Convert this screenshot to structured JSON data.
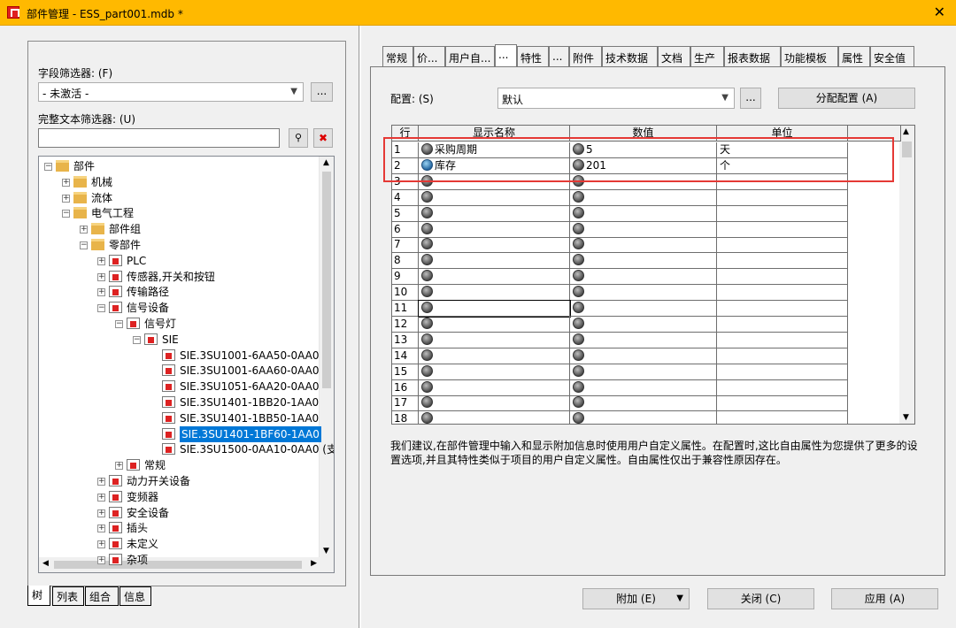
{
  "window": {
    "title": "部件管理 - ESS_part001.mdb *"
  },
  "left": {
    "field_filter_label": "字段筛选器: (F)",
    "field_filter_value": "- 未激活 -",
    "more_label": "...",
    "fulltext_filter_label": "完整文本筛选器: (U)",
    "fulltext_value": "",
    "tree": [
      {
        "label": "部件",
        "expander": "−",
        "icon": "folder"
      },
      {
        "label": "机械",
        "expander": "+",
        "icon": "folder"
      },
      {
        "label": "流体",
        "expander": "+",
        "icon": "folder"
      },
      {
        "label": "电气工程",
        "expander": "−",
        "icon": "folder"
      },
      {
        "label": "部件组",
        "expander": "+",
        "icon": "folder"
      },
      {
        "label": "零部件",
        "expander": "−",
        "icon": "folder"
      },
      {
        "label": "PLC",
        "expander": "+",
        "icon": "plc-icon"
      },
      {
        "label": "传感器,开关和按钮",
        "expander": "+",
        "icon": "sensor-icon"
      },
      {
        "label": "传输路径",
        "expander": "+",
        "icon": "transmission-icon"
      },
      {
        "label": "信号设备",
        "expander": "−",
        "icon": "signal-device-icon"
      },
      {
        "label": "信号灯",
        "expander": "−",
        "icon": "signal-device-icon"
      },
      {
        "label": "SIE",
        "expander": "−",
        "icon": "signal-device-icon"
      },
      {
        "label": "SIE.3SU1001-6AA50-0AA0",
        "expander": "",
        "icon": "part-icon"
      },
      {
        "label": "SIE.3SU1001-6AA60-0AA0",
        "expander": "",
        "icon": "part-icon"
      },
      {
        "label": "SIE.3SU1051-6AA20-0AA0",
        "expander": "",
        "icon": "part-icon"
      },
      {
        "label": "SIE.3SU1401-1BB20-1AA0",
        "expander": "",
        "icon": "part-icon"
      },
      {
        "label": "SIE.3SU1401-1BB50-1AA0",
        "expander": "",
        "icon": "part-icon"
      },
      {
        "label": "SIE.3SU1401-1BF60-1AA0",
        "expander": "",
        "icon": "part-icon",
        "selected": true
      },
      {
        "label": "SIE.3SU1500-0AA10-0AA0 (支",
        "expander": "",
        "icon": "part-icon"
      },
      {
        "label": "常规",
        "expander": "+",
        "icon": "signal-device-icon"
      },
      {
        "label": "动力开关设备",
        "expander": "+",
        "icon": "power-switch-icon"
      },
      {
        "label": "变频器",
        "expander": "+",
        "icon": "inverter-icon"
      },
      {
        "label": "安全设备",
        "expander": "+",
        "icon": "safety-icon"
      },
      {
        "label": "插头",
        "expander": "+",
        "icon": "plug-icon"
      },
      {
        "label": "未定义",
        "expander": "+",
        "icon": "question-icon"
      },
      {
        "label": "杂项",
        "expander": "+",
        "icon": "misc-icon"
      }
    ],
    "bottom_tabs": [
      "树",
      "列表",
      "组合",
      "信息"
    ]
  },
  "right": {
    "tabs": [
      "常规",
      "价...",
      "用户自...",
      "...",
      "特性",
      "...",
      "附件",
      "技术数据",
      "文档",
      "生产",
      "报表数据",
      "功能模板",
      "属性",
      "安全值"
    ],
    "active_tab": "...",
    "config_label": "配置: (S)",
    "config_value": "默认",
    "config_more": "...",
    "assign_button": "分配配置 (A)",
    "columns": [
      "行",
      "显示名称",
      "数值",
      "单位"
    ],
    "rows": [
      {
        "n": "1",
        "name": "采购周期",
        "value": "5",
        "unit": "天"
      },
      {
        "n": "2",
        "name": "库存",
        "value": "201",
        "unit": "个"
      },
      {
        "n": "3",
        "name": "",
        "value": "",
        "unit": ""
      },
      {
        "n": "4",
        "name": "",
        "value": "",
        "unit": ""
      },
      {
        "n": "5",
        "name": "",
        "value": "",
        "unit": ""
      },
      {
        "n": "6",
        "name": "",
        "value": "",
        "unit": ""
      },
      {
        "n": "7",
        "name": "",
        "value": "",
        "unit": ""
      },
      {
        "n": "8",
        "name": "",
        "value": "",
        "unit": ""
      },
      {
        "n": "9",
        "name": "",
        "value": "",
        "unit": ""
      },
      {
        "n": "10",
        "name": "",
        "value": "",
        "unit": ""
      },
      {
        "n": "11",
        "name": "",
        "value": "",
        "unit": ""
      },
      {
        "n": "12",
        "name": "",
        "value": "",
        "unit": ""
      },
      {
        "n": "13",
        "name": "",
        "value": "",
        "unit": ""
      },
      {
        "n": "14",
        "name": "",
        "value": "",
        "unit": ""
      },
      {
        "n": "15",
        "name": "",
        "value": "",
        "unit": ""
      },
      {
        "n": "16",
        "name": "",
        "value": "",
        "unit": ""
      },
      {
        "n": "17",
        "name": "",
        "value": "",
        "unit": ""
      },
      {
        "n": "18",
        "name": "",
        "value": "",
        "unit": ""
      }
    ],
    "description": "我们建议,在部件管理中输入和显示附加信息时使用用户自定义属性。在配置时,这比自由属性为您提供了更多的设置选项,并且其特性类似于项目的用户自定义属性。自由属性仅出于兼容性原因存在。"
  },
  "buttons": {
    "extra": "附加 (E)",
    "close": "关闭 (C)",
    "apply": "应用 (A)"
  },
  "colors": {
    "titlebar": "#ffb900",
    "selection": "#0078d7",
    "highlight_box": "#e53935"
  }
}
